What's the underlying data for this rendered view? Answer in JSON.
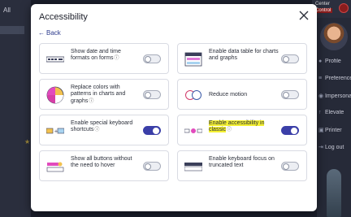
{
  "background": {
    "left_label": "All",
    "top_right_line1": "Center",
    "top_right_line2": "Control",
    "menu_items": [
      {
        "label": "Profile",
        "icon": "user-icon"
      },
      {
        "label": "Preferences",
        "icon": "sliders-icon"
      },
      {
        "label": "Impersonate",
        "icon": "eye-icon"
      },
      {
        "label": "Elevate",
        "icon": "arrow-up-icon"
      },
      {
        "label": "Printer",
        "icon": "printer-icon"
      },
      {
        "label": "Log out",
        "icon": "logout-icon"
      }
    ]
  },
  "modal": {
    "title": "Accessibility",
    "back_label": "Back",
    "close_icon": "close-icon",
    "options": [
      {
        "label": "Show date and time formats on forms",
        "enabled": false,
        "icon": "date-format-icon",
        "highlight": false
      },
      {
        "label": "Enable data table for charts and graphs",
        "enabled": false,
        "icon": "data-table-icon",
        "highlight": false
      },
      {
        "label": "Replace colors with patterns in charts and graphs",
        "enabled": false,
        "icon": "pie-pattern-icon",
        "highlight": false
      },
      {
        "label": "Reduce motion",
        "enabled": false,
        "icon": "reduce-motion-icon",
        "highlight": false
      },
      {
        "label": "Enable special keyboard shortcuts",
        "enabled": true,
        "icon": "keyboard-shortcut-icon",
        "highlight": false
      },
      {
        "label": "Enable accessibility in classic",
        "enabled": true,
        "icon": "classic-accessibility-icon",
        "highlight": true
      },
      {
        "label": "Show all buttons without the need to hover",
        "enabled": false,
        "icon": "hover-buttons-icon",
        "highlight": false
      },
      {
        "label": "Enable keyboard focus on truncated text",
        "enabled": false,
        "icon": "truncated-text-icon",
        "highlight": false
      }
    ],
    "colors": {
      "toggle_on": "#3b3fa8",
      "highlight": "#f4f032",
      "link": "#2c3a8c"
    }
  }
}
